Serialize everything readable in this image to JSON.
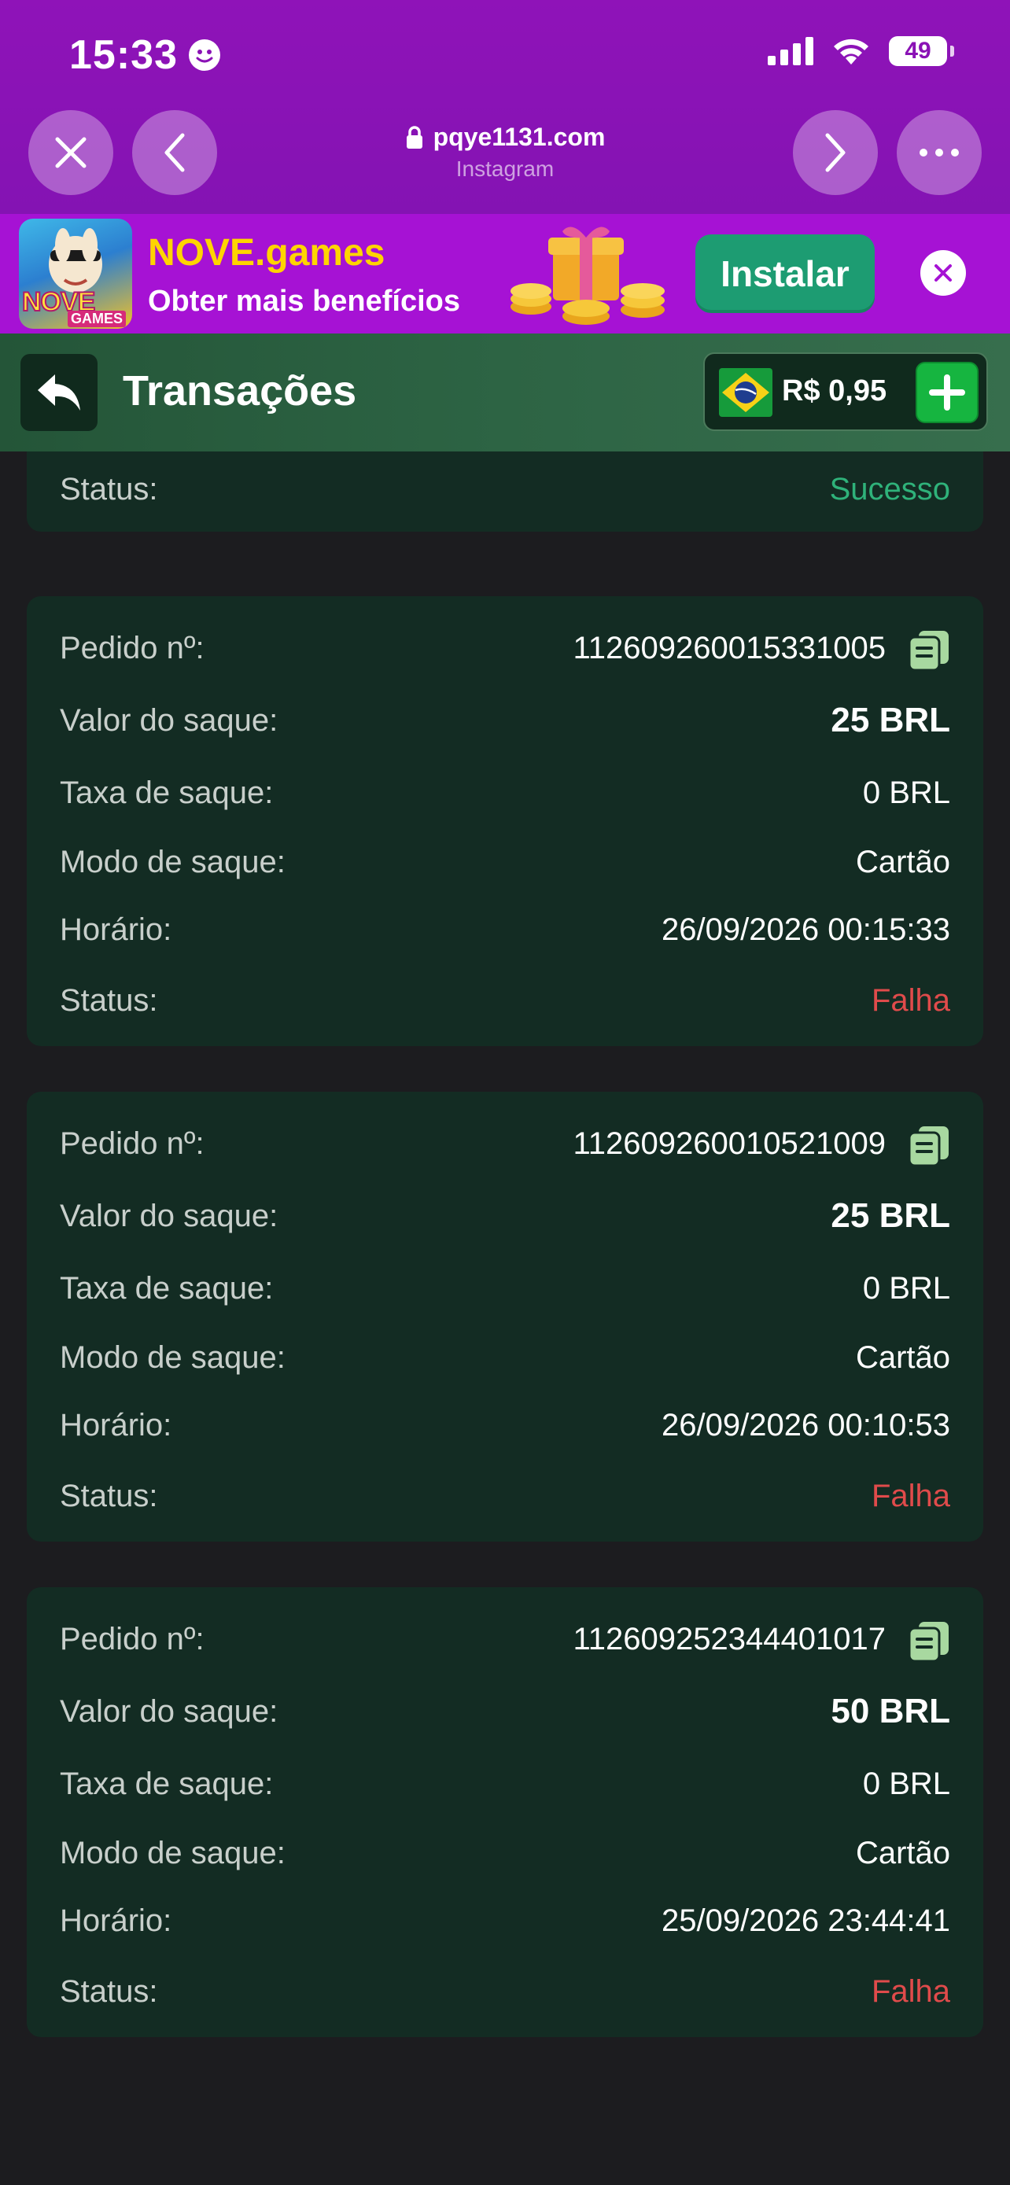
{
  "status_bar": {
    "time": "15:33",
    "battery": "49"
  },
  "browser": {
    "url": "pqye1131.com",
    "source": "Instagram"
  },
  "ad": {
    "title": "NOVE.games",
    "subtitle": "Obter mais benefícios",
    "install_label": "Instalar",
    "logo_text_1": "NOVE",
    "logo_text_2": "GAMES"
  },
  "header": {
    "title": "Transações",
    "balance": "R$ 0,95"
  },
  "labels": {
    "order": "Pedido nº:",
    "amount": "Valor do saque:",
    "fee": "Taxa de saque:",
    "mode": "Modo de saque:",
    "time": "Horário:",
    "status": "Status:"
  },
  "partial_card": {
    "status": "Sucesso"
  },
  "transactions": [
    {
      "order": "112609260015331005",
      "amount": "25 BRL",
      "fee": "0 BRL",
      "mode": "Cartão",
      "time": "26/09/2026 00:15:33",
      "status": "Falha"
    },
    {
      "order": "112609260010521009",
      "amount": "25 BRL",
      "fee": "0 BRL",
      "mode": "Cartão",
      "time": "26/09/2026 00:10:53",
      "status": "Falha"
    },
    {
      "order": "112609252344401017",
      "amount": "50 BRL",
      "fee": "0 BRL",
      "mode": "Cartão",
      "time": "25/09/2026 23:44:41",
      "status": "Falha"
    }
  ],
  "colors": {
    "success": "#2fb27a",
    "failure": "#e04b4b",
    "card": "#132c23",
    "chrome": "#8f13b8"
  }
}
